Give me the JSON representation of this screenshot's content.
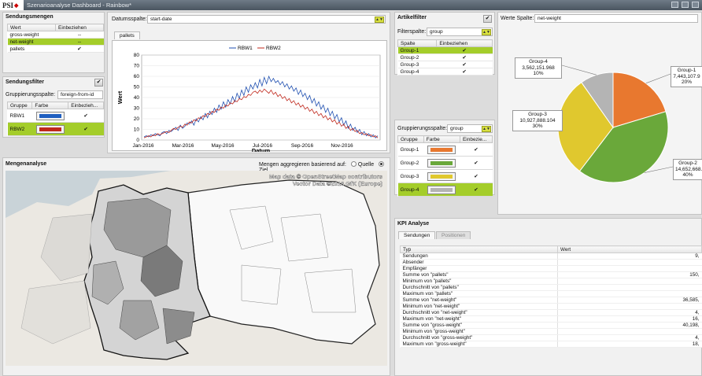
{
  "window": {
    "logo": "PSI",
    "title": "Szenarioanalyse Dashboard - Rainbow*"
  },
  "sendungsmengen": {
    "title": "Sendungsmengen",
    "headers": [
      "Wert",
      "Einbeziehen"
    ],
    "rows": [
      {
        "name": "gross-weight",
        "value": "--",
        "selected": false
      },
      {
        "name": "net-weight",
        "value": "--",
        "selected": true
      },
      {
        "name": "pallets",
        "value": "✔",
        "selected": false
      }
    ]
  },
  "sendungsfilter": {
    "title": "Sendungsfilter",
    "group_label": "Gruppierungsspalte:",
    "group_value": "foreign-from-id",
    "headers": [
      "Gruppe",
      "Farbe",
      "Einbezieh..."
    ],
    "rows": [
      {
        "name": "RBW1",
        "color": "#1f5fc0",
        "check": "✔",
        "selected": false
      },
      {
        "name": "RBW2",
        "color": "#c0281c",
        "check": "✔",
        "selected": true
      }
    ]
  },
  "datumsspalte": {
    "label": "Datumsspalte:",
    "value": "start-date",
    "tab": "pallets"
  },
  "artikelfilter": {
    "title": "Artikelfilter",
    "filter_label": "Filterspalte:",
    "filter_value": "group",
    "headers": [
      "Spalte",
      "Einbeziehen"
    ],
    "rows": [
      {
        "name": "Group-1",
        "check": "✔",
        "selected": true
      },
      {
        "name": "Group-2",
        "check": "✔",
        "selected": false
      },
      {
        "name": "Group-3",
        "check": "✔",
        "selected": false
      },
      {
        "name": "Group-4",
        "check": "✔",
        "selected": false
      }
    ],
    "group_label": "Gruppierungsspalte:",
    "group_value": "group",
    "color_headers": [
      "Gruppe",
      "Farbe",
      "Einbezie..."
    ],
    "color_rows": [
      {
        "name": "Group-1",
        "color": "#e8782f",
        "check": "✔",
        "selected": false
      },
      {
        "name": "Group-2",
        "color": "#6aa83a",
        "check": "✔",
        "selected": false
      },
      {
        "name": "Group-3",
        "color": "#e0c82e",
        "check": "✔",
        "selected": false
      },
      {
        "name": "Group-4",
        "color": "#b4b4b4",
        "check": "✔",
        "selected": true
      }
    ]
  },
  "werte": {
    "label": "Werte Spalte:",
    "value": "net-weight"
  },
  "mengenanalyse": {
    "title": "Mengenanalyse",
    "aggregate_label": "Mengen aggregieren basierend auf:",
    "option_source": "Quelle",
    "option_target": "Ziel",
    "selected": "Ziel",
    "attribution_1": "Map data © OpenStreetMap contributors",
    "attribution_2": "Vector Data ©2018 GfK (Europe)"
  },
  "kpi": {
    "title": "KPI Analyse",
    "tabs": [
      "Sendungen",
      "Positionen"
    ],
    "headers": [
      "Typ",
      "Wert"
    ],
    "rows": [
      [
        "Sendungen",
        "9,"
      ],
      [
        "Absender",
        ""
      ],
      [
        "Empfänger",
        ""
      ],
      [
        "Summe von \"pallets\"",
        "150,"
      ],
      [
        "Minimum von \"pallets\"",
        ""
      ],
      [
        "Durchschnitt von \"pallets\"",
        ""
      ],
      [
        "Maximum von \"pallets\"",
        ""
      ],
      [
        "Summe von \"net-weight\"",
        "36,585,"
      ],
      [
        "Minimum von \"net-weight\"",
        ""
      ],
      [
        "Durchschnitt von \"net-weight\"",
        "4,"
      ],
      [
        "Maximum von \"net-weight\"",
        "16,"
      ],
      [
        "Summe von \"gross-weight\"",
        "40,198,"
      ],
      [
        "Minimum von \"gross-weight\"",
        ""
      ],
      [
        "Durchschnitt von \"gross-weight\"",
        "4,"
      ],
      [
        "Maximum von \"gross-weight\"",
        "18,"
      ]
    ]
  },
  "chart_data": [
    {
      "type": "line",
      "title": "",
      "xlabel": "Datum",
      "ylabel": "Wert",
      "ylim": [
        0,
        80
      ],
      "yticks": [
        0,
        10,
        20,
        30,
        40,
        50,
        60,
        70,
        80
      ],
      "xticks": [
        "Jan-2016",
        "Mar-2016",
        "May-2016",
        "Jul-2016",
        "Sep-2016",
        "Nov-2016"
      ],
      "legend_position": "top",
      "series": [
        {
          "name": "RBW1",
          "color": "#1f4fb0",
          "values": [
            3,
            4,
            3,
            5,
            4,
            6,
            5,
            4,
            7,
            8,
            6,
            9,
            8,
            10,
            12,
            9,
            14,
            11,
            13,
            16,
            15,
            18,
            14,
            20,
            17,
            22,
            19,
            25,
            21,
            27,
            24,
            30,
            26,
            33,
            29,
            36,
            31,
            38,
            34,
            41,
            36,
            44,
            39,
            47,
            42,
            50,
            45,
            52,
            48,
            54,
            49,
            57,
            51,
            59,
            53,
            60,
            55,
            58,
            54,
            56,
            52,
            55,
            50,
            53,
            48,
            51,
            46,
            49,
            43,
            47,
            41,
            44,
            38,
            42,
            35,
            39,
            32,
            36,
            29,
            33,
            26,
            30,
            23,
            27,
            20,
            24,
            17,
            21,
            14,
            18,
            11,
            15,
            9,
            12,
            7,
            10,
            5,
            8,
            4,
            6,
            3,
            5,
            2,
            4
          ]
        },
        {
          "name": "RBW2",
          "color": "#c0281c",
          "values": [
            2,
            3,
            4,
            3,
            5,
            4,
            6,
            5,
            6,
            7,
            8,
            7,
            9,
            11,
            10,
            12,
            13,
            12,
            15,
            14,
            17,
            16,
            19,
            18,
            21,
            20,
            23,
            22,
            25,
            24,
            27,
            26,
            29,
            28,
            31,
            30,
            33,
            32,
            35,
            34,
            37,
            36,
            39,
            38,
            41,
            40,
            43,
            42,
            45,
            46,
            44,
            47,
            45,
            48,
            46,
            44,
            47,
            43,
            45,
            41,
            43,
            39,
            41,
            37,
            39,
            35,
            37,
            33,
            35,
            31,
            33,
            29,
            31,
            27,
            29,
            25,
            27,
            23,
            25,
            21,
            23,
            19,
            21,
            17,
            19,
            15,
            17,
            13,
            15,
            11,
            13,
            9,
            11,
            8,
            9,
            6,
            7,
            5,
            6,
            4,
            5,
            3,
            4,
            2
          ]
        }
      ]
    },
    {
      "type": "pie",
      "title": "",
      "slices": [
        {
          "name": "Group-1",
          "value": 7443107.9,
          "percent": 20,
          "label_value": "7,443,107.9",
          "color": "#e8782f"
        },
        {
          "name": "Group-2",
          "value": 14652668,
          "percent": 40,
          "label_value": "14,652,668.",
          "color": "#6aa83a"
        },
        {
          "name": "Group-3",
          "value": 10927888.104,
          "percent": 30,
          "label_value": "10,927,888.104",
          "color": "#e0c82e"
        },
        {
          "name": "Group-4",
          "value": 3562151.968,
          "percent": 10,
          "label_value": "3,562,151.968",
          "color": "#b4b4b4"
        }
      ]
    }
  ]
}
